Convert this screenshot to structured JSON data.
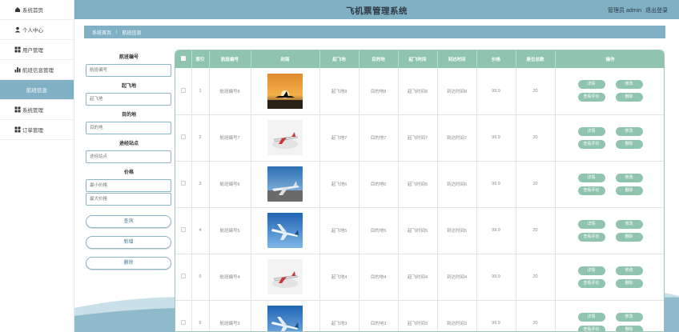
{
  "header": {
    "title": "飞机票管理系统",
    "user_label": "管理员 admin",
    "logout": "退出登录"
  },
  "sidebar": {
    "items": [
      {
        "label": "系统首页",
        "icon": "home-icon"
      },
      {
        "label": "个人中心",
        "icon": "user-icon"
      },
      {
        "label": "用户管理",
        "icon": "grid-icon"
      },
      {
        "label": "航班信息管理",
        "icon": "bar-chart-icon"
      },
      {
        "label": "航班信息",
        "icon": ""
      },
      {
        "label": "系统管理",
        "icon": "grid-icon"
      },
      {
        "label": "订单管理",
        "icon": "grid-icon"
      }
    ]
  },
  "breadcrumb": {
    "home": "系统首页",
    "current": "航班信息"
  },
  "filters": {
    "flight_no_label": "航班编号",
    "flight_no_placeholder": "航班编号",
    "origin_label": "起飞地",
    "origin_placeholder": "起飞地",
    "dest_label": "目的地",
    "dest_placeholder": "目的地",
    "stop_label": "途经站点",
    "stop_placeholder": "途经站点",
    "price_label": "价格",
    "min_price_placeholder": "最小价格",
    "max_price_placeholder": "最大价格",
    "search_button": "查询",
    "add_button": "新增",
    "delete_button": "删除"
  },
  "table": {
    "headers": [
      "",
      "索引",
      "航班编号",
      "封面",
      "起飞地",
      "目的地",
      "起飞时间",
      "到达时间",
      "价格",
      "座位总数",
      "操作"
    ],
    "ops": {
      "detail": "详情",
      "edit": "修改",
      "review": "查看评论",
      "delete": "删除"
    },
    "rows": [
      {
        "index": "1",
        "flight_no": "航班编号8",
        "origin": "起飞地8",
        "dest": "目的地8",
        "depart": "起飞时间8",
        "arrive": "到达时间8",
        "price": "99.9",
        "seats": "20",
        "cover": "sunset-plane"
      },
      {
        "index": "2",
        "flight_no": "航班编号7",
        "origin": "起飞地7",
        "dest": "目的地7",
        "depart": "起飞时间7",
        "arrive": "到达时间7",
        "price": "99.9",
        "seats": "20",
        "cover": "white-plane"
      },
      {
        "index": "3",
        "flight_no": "航班编号6",
        "origin": "起飞地6",
        "dest": "目的地6",
        "depart": "起飞时间6",
        "arrive": "到达时间6",
        "price": "99.9",
        "seats": "20",
        "cover": "runway-plane"
      },
      {
        "index": "4",
        "flight_no": "航班编号5",
        "origin": "起飞地5",
        "dest": "目的地5",
        "depart": "起飞时间5",
        "arrive": "到达时间5",
        "price": "99.9",
        "seats": "20",
        "cover": "blue-sky-plane"
      },
      {
        "index": "5",
        "flight_no": "航班编号4",
        "origin": "起飞地4",
        "dest": "目的地4",
        "depart": "起飞时间4",
        "arrive": "到达时间4",
        "price": "99.9",
        "seats": "20",
        "cover": "white-plane"
      },
      {
        "index": "6",
        "flight_no": "航班编号3",
        "origin": "起飞地3",
        "dest": "目的地3",
        "depart": "起飞时间3",
        "arrive": "到达时间3",
        "price": "99.9",
        "seats": "20",
        "cover": "blue-sky-plane"
      }
    ]
  },
  "colors": {
    "primary": "#7fb0c4",
    "accent": "#8fc4ae",
    "sidebar_active": "#7fb0c4"
  }
}
